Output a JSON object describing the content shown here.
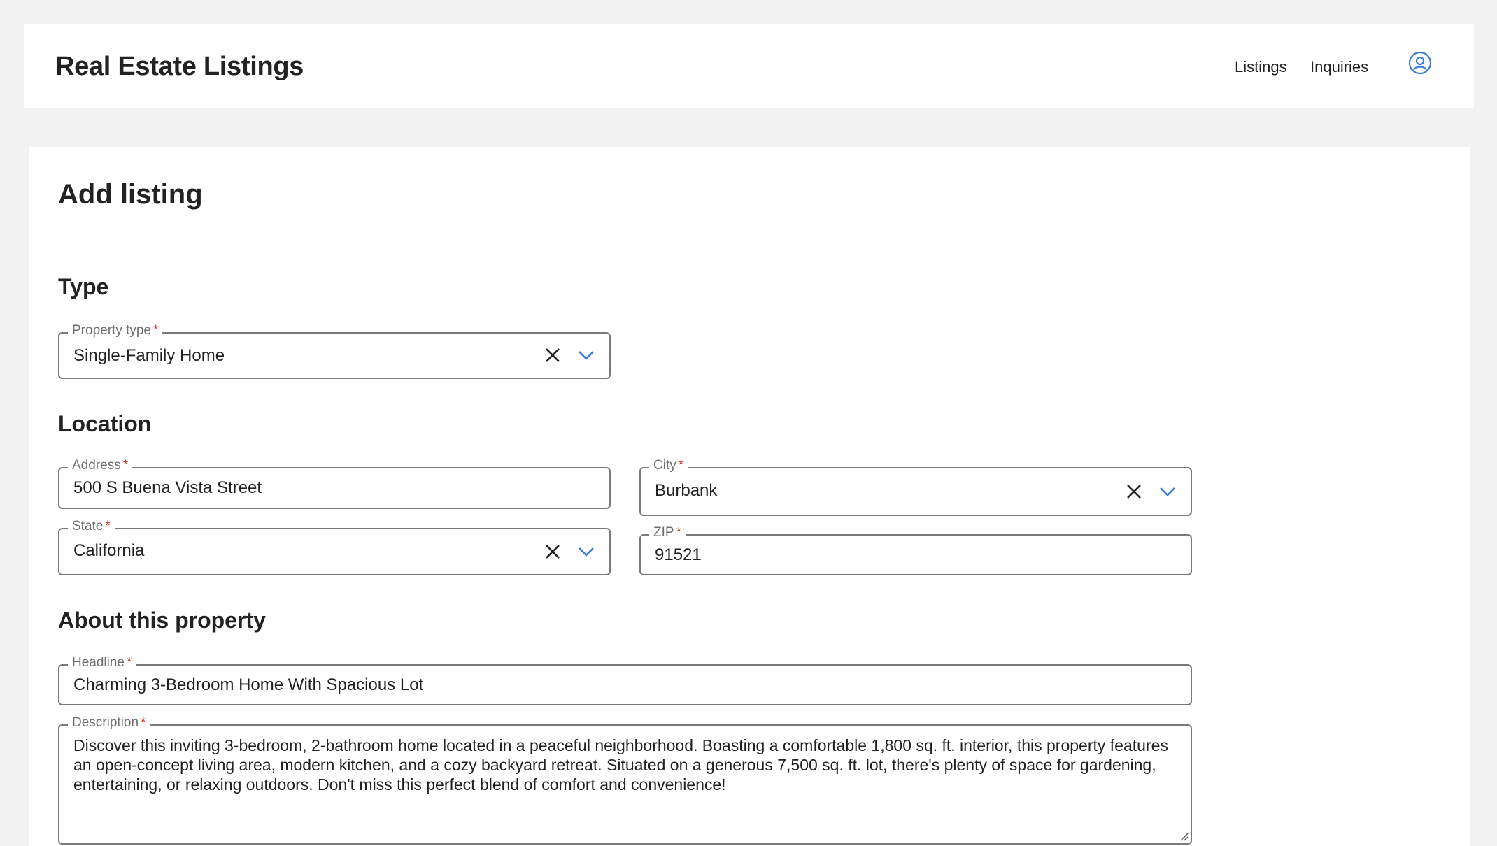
{
  "header": {
    "title": "Real Estate Listings",
    "nav": {
      "listings": "Listings",
      "inquiries": "Inquiries"
    },
    "avatar_icon": "user-circle-icon"
  },
  "page": {
    "title": "Add listing"
  },
  "sections": {
    "type": "Type",
    "location": "Location",
    "about": "About this property"
  },
  "fields": {
    "property_type": {
      "label": "Property type",
      "value": "Single-Family Home"
    },
    "address": {
      "label": "Address",
      "value": "500 S Buena Vista Street"
    },
    "city": {
      "label": "City",
      "value": "Burbank"
    },
    "state": {
      "label": "State",
      "value": "California"
    },
    "zip": {
      "label": "ZIP",
      "value": "91521"
    },
    "headline": {
      "label": "Headline",
      "value": "Charming 3-Bedroom Home With Spacious Lot"
    },
    "description": {
      "label": "Description",
      "value": "Discover this inviting 3-bedroom, 2-bathroom home located in a peaceful neighborhood. Boasting a comfortable 1,800 sq. ft. interior, this property features an open-concept living area, modern kitchen, and a cozy backyard retreat. Situated on a generous 7,500 sq. ft. lot, there's plenty of space for gardening, entertaining, or relaxing outdoors. Don't miss this perfect blend of comfort and convenience!"
    }
  },
  "required_marker": "*",
  "colors": {
    "accent": "#3b7bd9",
    "required": "#d93025",
    "page_bg": "#f2f2f2"
  }
}
